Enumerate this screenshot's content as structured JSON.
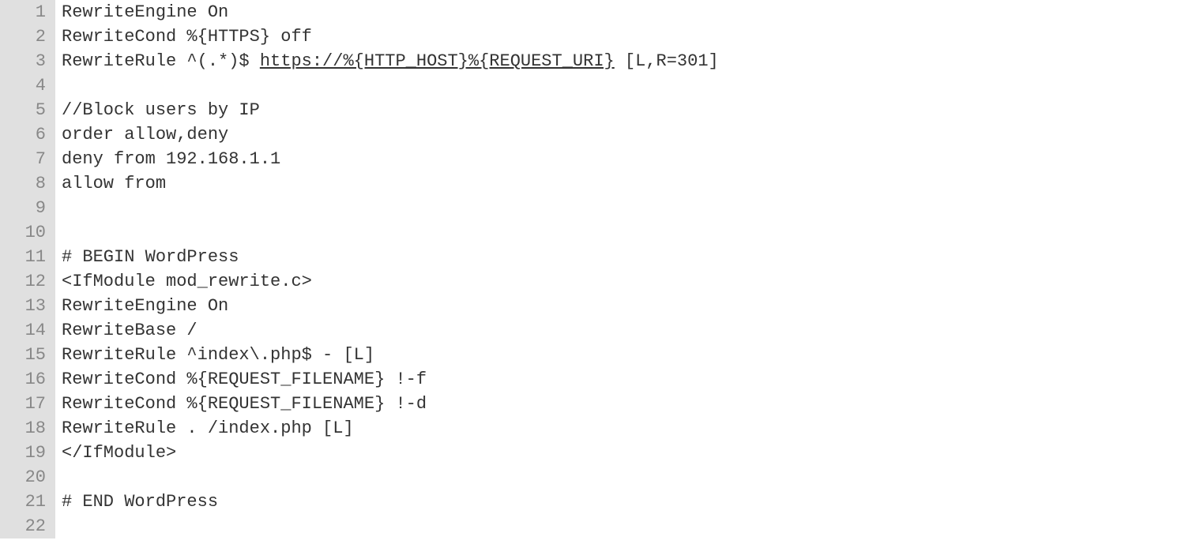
{
  "code": {
    "lines": [
      {
        "n": "1",
        "segments": [
          {
            "text": "RewriteEngine On"
          }
        ]
      },
      {
        "n": "2",
        "segments": [
          {
            "text": "RewriteCond %{HTTPS} off"
          }
        ]
      },
      {
        "n": "3",
        "segments": [
          {
            "text": "RewriteRule ^(.*)$ "
          },
          {
            "text": "https://%{HTTP_HOST}%{REQUEST_URI}",
            "link": true
          },
          {
            "text": " [L,R=301]"
          }
        ]
      },
      {
        "n": "4",
        "segments": [
          {
            "text": ""
          }
        ]
      },
      {
        "n": "5",
        "segments": [
          {
            "text": "//Block users by IP"
          }
        ]
      },
      {
        "n": "6",
        "segments": [
          {
            "text": "order allow,deny"
          }
        ]
      },
      {
        "n": "7",
        "segments": [
          {
            "text": "deny from 192.168.1.1"
          }
        ]
      },
      {
        "n": "8",
        "segments": [
          {
            "text": "allow from"
          }
        ]
      },
      {
        "n": "9",
        "segments": [
          {
            "text": ""
          }
        ]
      },
      {
        "n": "10",
        "segments": [
          {
            "text": ""
          }
        ]
      },
      {
        "n": "11",
        "segments": [
          {
            "text": "# BEGIN WordPress"
          }
        ]
      },
      {
        "n": "12",
        "segments": [
          {
            "text": "<IfModule mod_rewrite.c>"
          }
        ]
      },
      {
        "n": "13",
        "segments": [
          {
            "text": "RewriteEngine On"
          }
        ]
      },
      {
        "n": "14",
        "segments": [
          {
            "text": "RewriteBase /"
          }
        ]
      },
      {
        "n": "15",
        "segments": [
          {
            "text": "RewriteRule ^index\\.php$ - [L]"
          }
        ]
      },
      {
        "n": "16",
        "segments": [
          {
            "text": "RewriteCond %{REQUEST_FILENAME} !-f"
          }
        ]
      },
      {
        "n": "17",
        "segments": [
          {
            "text": "RewriteCond %{REQUEST_FILENAME} !-d"
          }
        ]
      },
      {
        "n": "18",
        "segments": [
          {
            "text": "RewriteRule . /index.php [L]"
          }
        ]
      },
      {
        "n": "19",
        "segments": [
          {
            "text": "</IfModule>"
          }
        ]
      },
      {
        "n": "20",
        "segments": [
          {
            "text": ""
          }
        ]
      },
      {
        "n": "21",
        "segments": [
          {
            "text": "# END WordPress"
          }
        ]
      },
      {
        "n": "22",
        "segments": [
          {
            "text": ""
          }
        ]
      }
    ]
  }
}
